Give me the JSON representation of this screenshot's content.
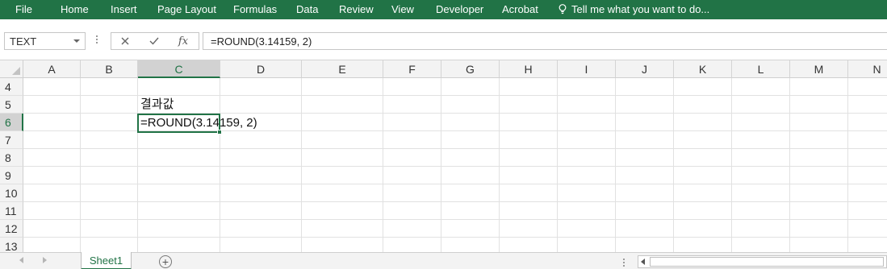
{
  "ribbon": {
    "tabs": [
      "File",
      "Home",
      "Insert",
      "Page Layout",
      "Formulas",
      "Data",
      "Review",
      "View",
      "Developer",
      "Acrobat"
    ],
    "tell_me": "Tell me what you want to do...",
    "tell_me_icon": "lightbulb-icon",
    "color": "#217346"
  },
  "formula_bar": {
    "name_box": "TEXT",
    "cancel_icon": "close-icon",
    "enter_icon": "check-icon",
    "function_label": "fx",
    "formula": "=ROUND(3.14159, 2)"
  },
  "grid": {
    "columns": [
      "A",
      "B",
      "C",
      "D",
      "E",
      "F",
      "G",
      "H",
      "I",
      "J",
      "K",
      "L",
      "M",
      "N"
    ],
    "rows": [
      "4",
      "5",
      "6",
      "7",
      "8",
      "9",
      "10",
      "11",
      "12",
      "13"
    ],
    "selected_column": "C",
    "selected_row": "6",
    "active_cell": "C6",
    "cells": {
      "C5": "결과값",
      "C6": "=ROUND(3.14159, 2)"
    }
  },
  "sheets": {
    "tabs": [
      "Sheet1"
    ],
    "active": "Sheet1",
    "add_icon": "plus-circle-icon"
  }
}
